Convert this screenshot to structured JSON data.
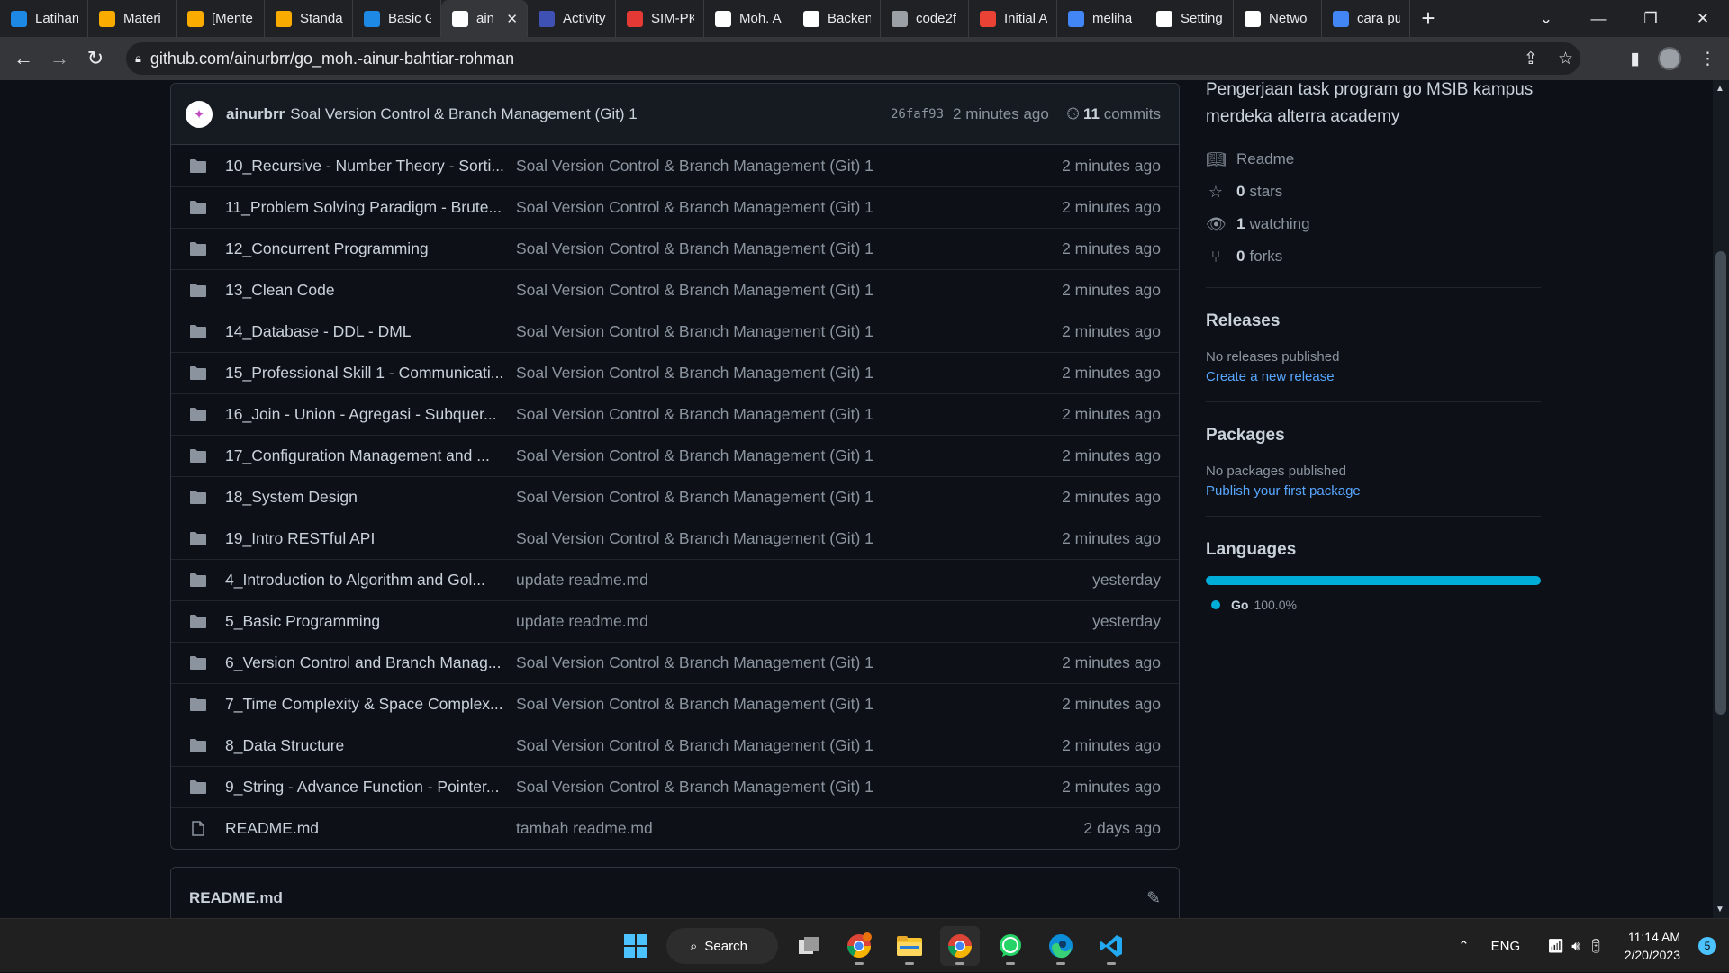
{
  "browser": {
    "tabs": [
      {
        "label": "Latihan",
        "color": "#1e88e5",
        "icon": "dash-icon"
      },
      {
        "label": "Materi",
        "color": "#f9ab00",
        "icon": "slides-icon"
      },
      {
        "label": "[Mente",
        "color": "#f9ab00",
        "icon": "slides-icon"
      },
      {
        "label": "Standa",
        "color": "#f9ab00",
        "icon": "slides-icon"
      },
      {
        "label": "Basic G",
        "color": "#1e88e5",
        "icon": "go-icon"
      },
      {
        "label": "ain",
        "color": "#ffffff",
        "icon": "github-icon",
        "active": true
      },
      {
        "label": "Activity",
        "color": "#3f51b5",
        "icon": "bar-icon"
      },
      {
        "label": "SIM-PK",
        "color": "#e53935",
        "icon": "logo-icon"
      },
      {
        "label": "Moh. A",
        "color": "#ffffff",
        "icon": "logo-icon"
      },
      {
        "label": "Backen",
        "color": "#ffffff",
        "icon": "r-icon"
      },
      {
        "label": "code2f",
        "color": "#9aa0a6",
        "icon": "globe-icon"
      },
      {
        "label": "Initial A",
        "color": "#ea4335",
        "icon": "gmail-icon"
      },
      {
        "label": "meliha",
        "color": "#4285f4",
        "icon": "google-icon"
      },
      {
        "label": "Setting",
        "color": "#ffffff",
        "icon": "medium-icon"
      },
      {
        "label": "Netwo",
        "color": "#ffffff",
        "icon": "github-icon"
      },
      {
        "label": "cara pu",
        "color": "#4285f4",
        "icon": "google-icon"
      }
    ],
    "url": "github.com/ainurbrr/go_moh.-ainur-bahtiar-rohman"
  },
  "commit": {
    "user": "ainurbrr",
    "message": "Soal Version Control & Branch Management (Git) 1",
    "hash": "26faf93",
    "time": "2 minutes ago",
    "count": "11",
    "count_label": "commits"
  },
  "files": [
    {
      "name": "10_Recursive - Number Theory - Sorti...",
      "msg": "Soal Version Control & Branch Management (Git) 1",
      "age": "2 minutes ago",
      "type": "folder"
    },
    {
      "name": "11_Problem Solving Paradigm - Brute...",
      "msg": "Soal Version Control & Branch Management (Git) 1",
      "age": "2 minutes ago",
      "type": "folder"
    },
    {
      "name": "12_Concurrent Programming",
      "msg": "Soal Version Control & Branch Management (Git) 1",
      "age": "2 minutes ago",
      "type": "folder"
    },
    {
      "name": "13_Clean Code",
      "msg": "Soal Version Control & Branch Management (Git) 1",
      "age": "2 minutes ago",
      "type": "folder"
    },
    {
      "name": "14_Database - DDL - DML",
      "msg": "Soal Version Control & Branch Management (Git) 1",
      "age": "2 minutes ago",
      "type": "folder"
    },
    {
      "name": "15_Professional Skill 1 - Communicati...",
      "msg": "Soal Version Control & Branch Management (Git) 1",
      "age": "2 minutes ago",
      "type": "folder"
    },
    {
      "name": "16_Join - Union - Agregasi - Subquer...",
      "msg": "Soal Version Control & Branch Management (Git) 1",
      "age": "2 minutes ago",
      "type": "folder"
    },
    {
      "name": "17_Configuration Management and ...",
      "msg": "Soal Version Control & Branch Management (Git) 1",
      "age": "2 minutes ago",
      "type": "folder"
    },
    {
      "name": "18_System Design",
      "msg": "Soal Version Control & Branch Management (Git) 1",
      "age": "2 minutes ago",
      "type": "folder"
    },
    {
      "name": "19_Intro RESTful API",
      "msg": "Soal Version Control & Branch Management (Git) 1",
      "age": "2 minutes ago",
      "type": "folder"
    },
    {
      "name": "4_Introduction to Algorithm and Gol...",
      "msg": "update readme.md",
      "age": "yesterday",
      "type": "folder"
    },
    {
      "name": "5_Basic Programming",
      "msg": "update readme.md",
      "age": "yesterday",
      "type": "folder"
    },
    {
      "name": "6_Version Control and Branch Manag...",
      "msg": "Soal Version Control & Branch Management (Git) 1",
      "age": "2 minutes ago",
      "type": "folder"
    },
    {
      "name": "7_Time Complexity & Space Complex...",
      "msg": "Soal Version Control & Branch Management (Git) 1",
      "age": "2 minutes ago",
      "type": "folder"
    },
    {
      "name": "8_Data Structure",
      "msg": "Soal Version Control & Branch Management (Git) 1",
      "age": "2 minutes ago",
      "type": "folder"
    },
    {
      "name": "9_String - Advance Function - Pointer...",
      "msg": "Soal Version Control & Branch Management (Git) 1",
      "age": "2 minutes ago",
      "type": "folder"
    },
    {
      "name": "README.md",
      "msg": "tambah readme.md",
      "age": "2 days ago",
      "type": "file"
    }
  ],
  "readme": {
    "title": "README.md"
  },
  "sidebar": {
    "about": "Pengerjaan task program go MSIB kampus merdeka alterra academy",
    "readme": "Readme",
    "stars_n": "0",
    "stars": "stars",
    "watching_n": "1",
    "watching": "watching",
    "forks_n": "0",
    "forks": "forks",
    "releases_title": "Releases",
    "releases_none": "No releases published",
    "releases_link": "Create a new release",
    "packages_title": "Packages",
    "packages_none": "No packages published",
    "packages_link": "Publish your first package",
    "languages_title": "Languages",
    "lang_name": "Go",
    "lang_pct": "100.0%",
    "lang_fraction": 1.0,
    "lang_color": "#00add8"
  },
  "taskbar": {
    "search": "Search",
    "lang": "ENG",
    "time": "11:14 AM",
    "date": "2/20/2023",
    "notif": "5"
  }
}
